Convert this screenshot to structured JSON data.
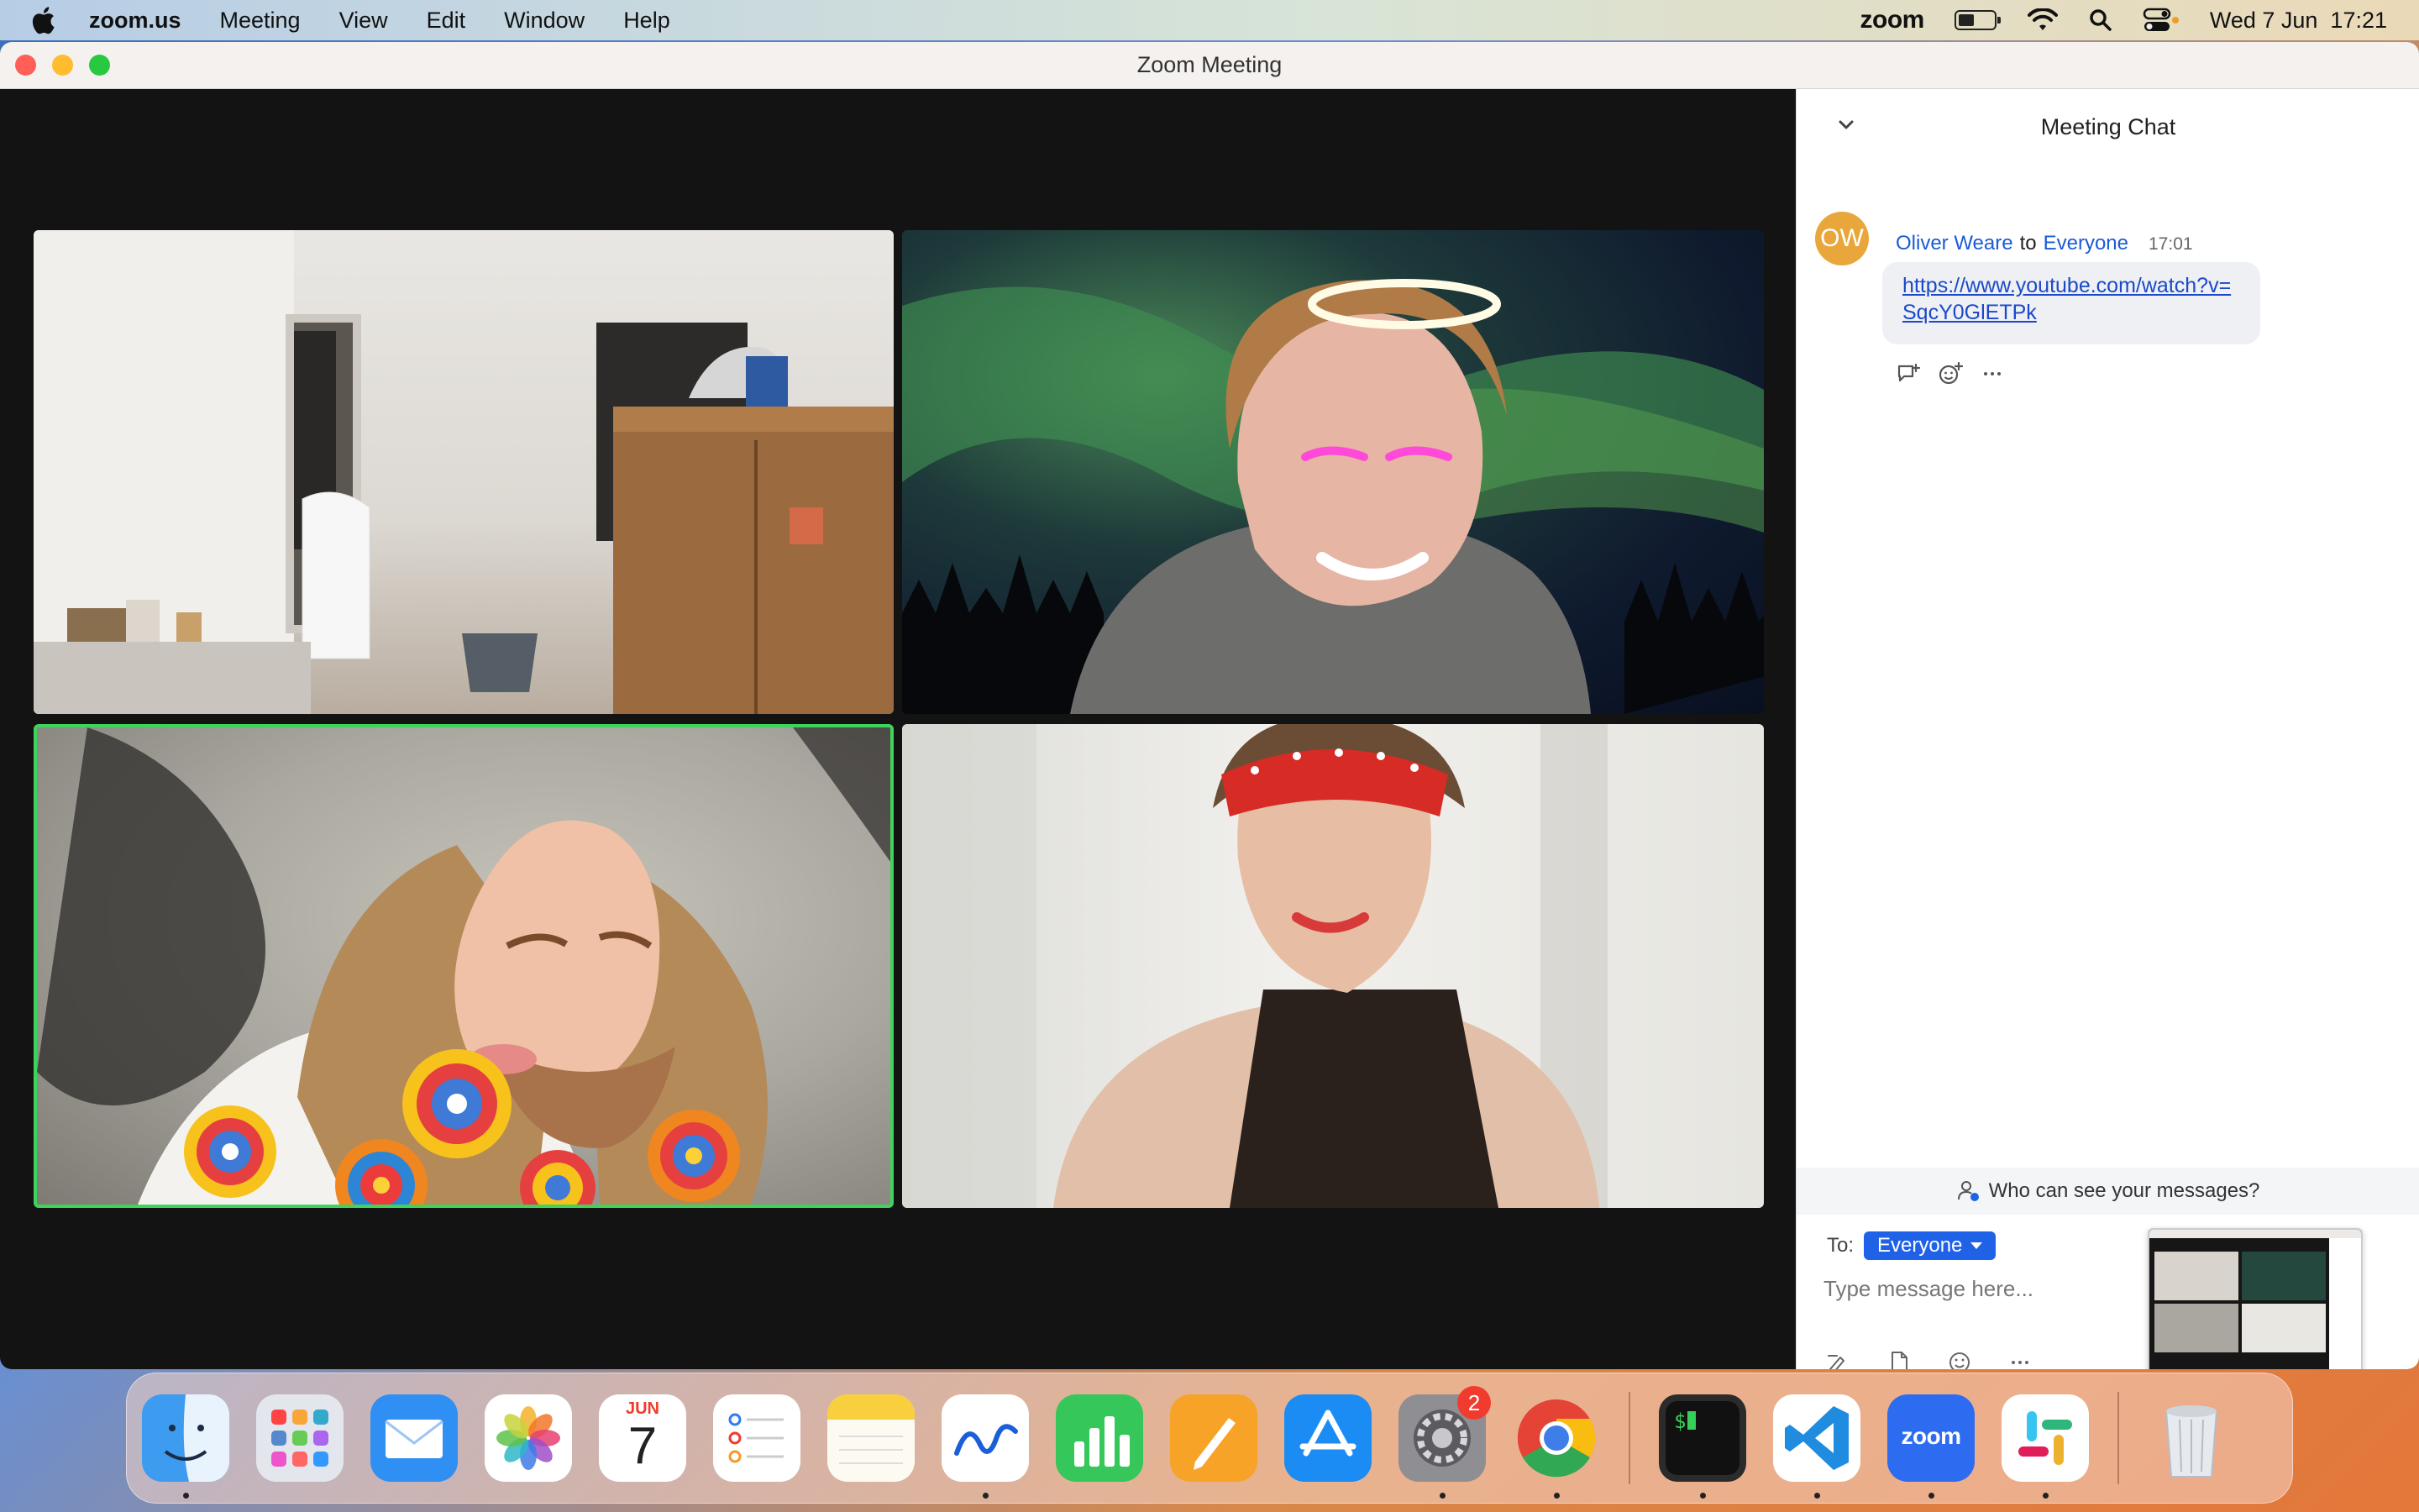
{
  "menubar": {
    "app_name": "zoom.us",
    "menus": [
      "Meeting",
      "View",
      "Edit",
      "Window",
      "Help"
    ],
    "status_app": "zoom",
    "datetime": "Wed 7 Jun  17:21"
  },
  "window": {
    "title": "Zoom Meeting"
  },
  "video_tiles": [
    {
      "label": "participant-bedroom-camera"
    },
    {
      "label": "participant-halo-filter"
    },
    {
      "label": "participant-lollipop-filter",
      "active_speaker": true
    },
    {
      "label": "participant-headband-filter"
    }
  ],
  "chat": {
    "title": "Meeting Chat",
    "messages": [
      {
        "avatar_initials": "OW",
        "sender": "Oliver Weare",
        "to_word": "to",
        "recipient": "Everyone",
        "time": "17:01",
        "link": "https://www.youtube.com/watch?v=SqcY0GlETPk"
      }
    ],
    "visibility_text": "Who can see your messages?",
    "to_label": "To:",
    "to_value": "Everyone",
    "input_placeholder": "Type message here..."
  },
  "dock": {
    "calendar_month": "JUN",
    "calendar_day": "7",
    "settings_badge": "2",
    "zoom_label": "zoom"
  },
  "colors": {
    "active_speaker_border": "#3ed35a",
    "link": "#1b49c9",
    "to_pill": "#1f62e8",
    "avatar": "#e9a73b"
  }
}
